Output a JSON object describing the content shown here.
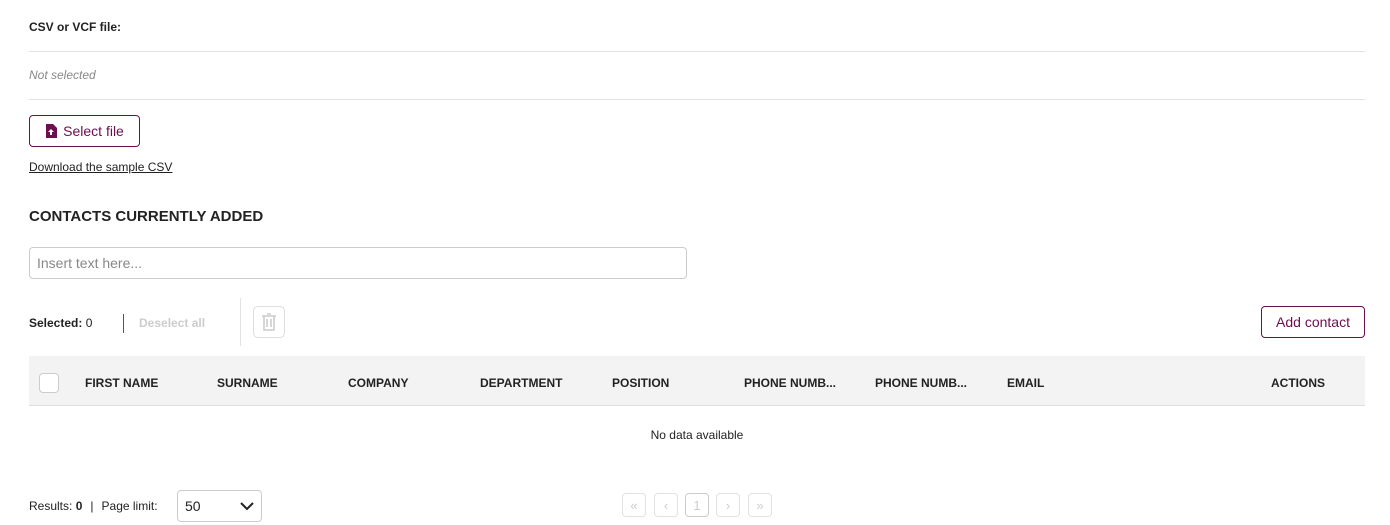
{
  "file": {
    "label": "CSV or VCF file:",
    "status": "Not selected",
    "select_button": "Select file",
    "sample_link": "Download the sample CSV"
  },
  "contacts": {
    "title": "CONTACTS CURRENTLY ADDED",
    "search_placeholder": "Insert text here...",
    "selected_label": "Selected:",
    "selected_count": "0",
    "deselect_all": "Deselect all",
    "add_contact": "Add contact"
  },
  "table": {
    "columns": [
      "FIRST NAME",
      "SURNAME",
      "COMPANY",
      "DEPARTMENT",
      "POSITION",
      "PHONE NUMB...",
      "PHONE NUMB...",
      "EMAIL",
      "ACTIONS"
    ],
    "empty": "No data available"
  },
  "footer": {
    "results_label": "Results:",
    "results_count": "0",
    "divider": "|",
    "page_limit_label": "Page limit:",
    "page_limit": "50",
    "pages": [
      "«",
      "‹",
      "1",
      "›",
      "»"
    ]
  },
  "colors": {
    "accent": "#6b0f4e"
  }
}
